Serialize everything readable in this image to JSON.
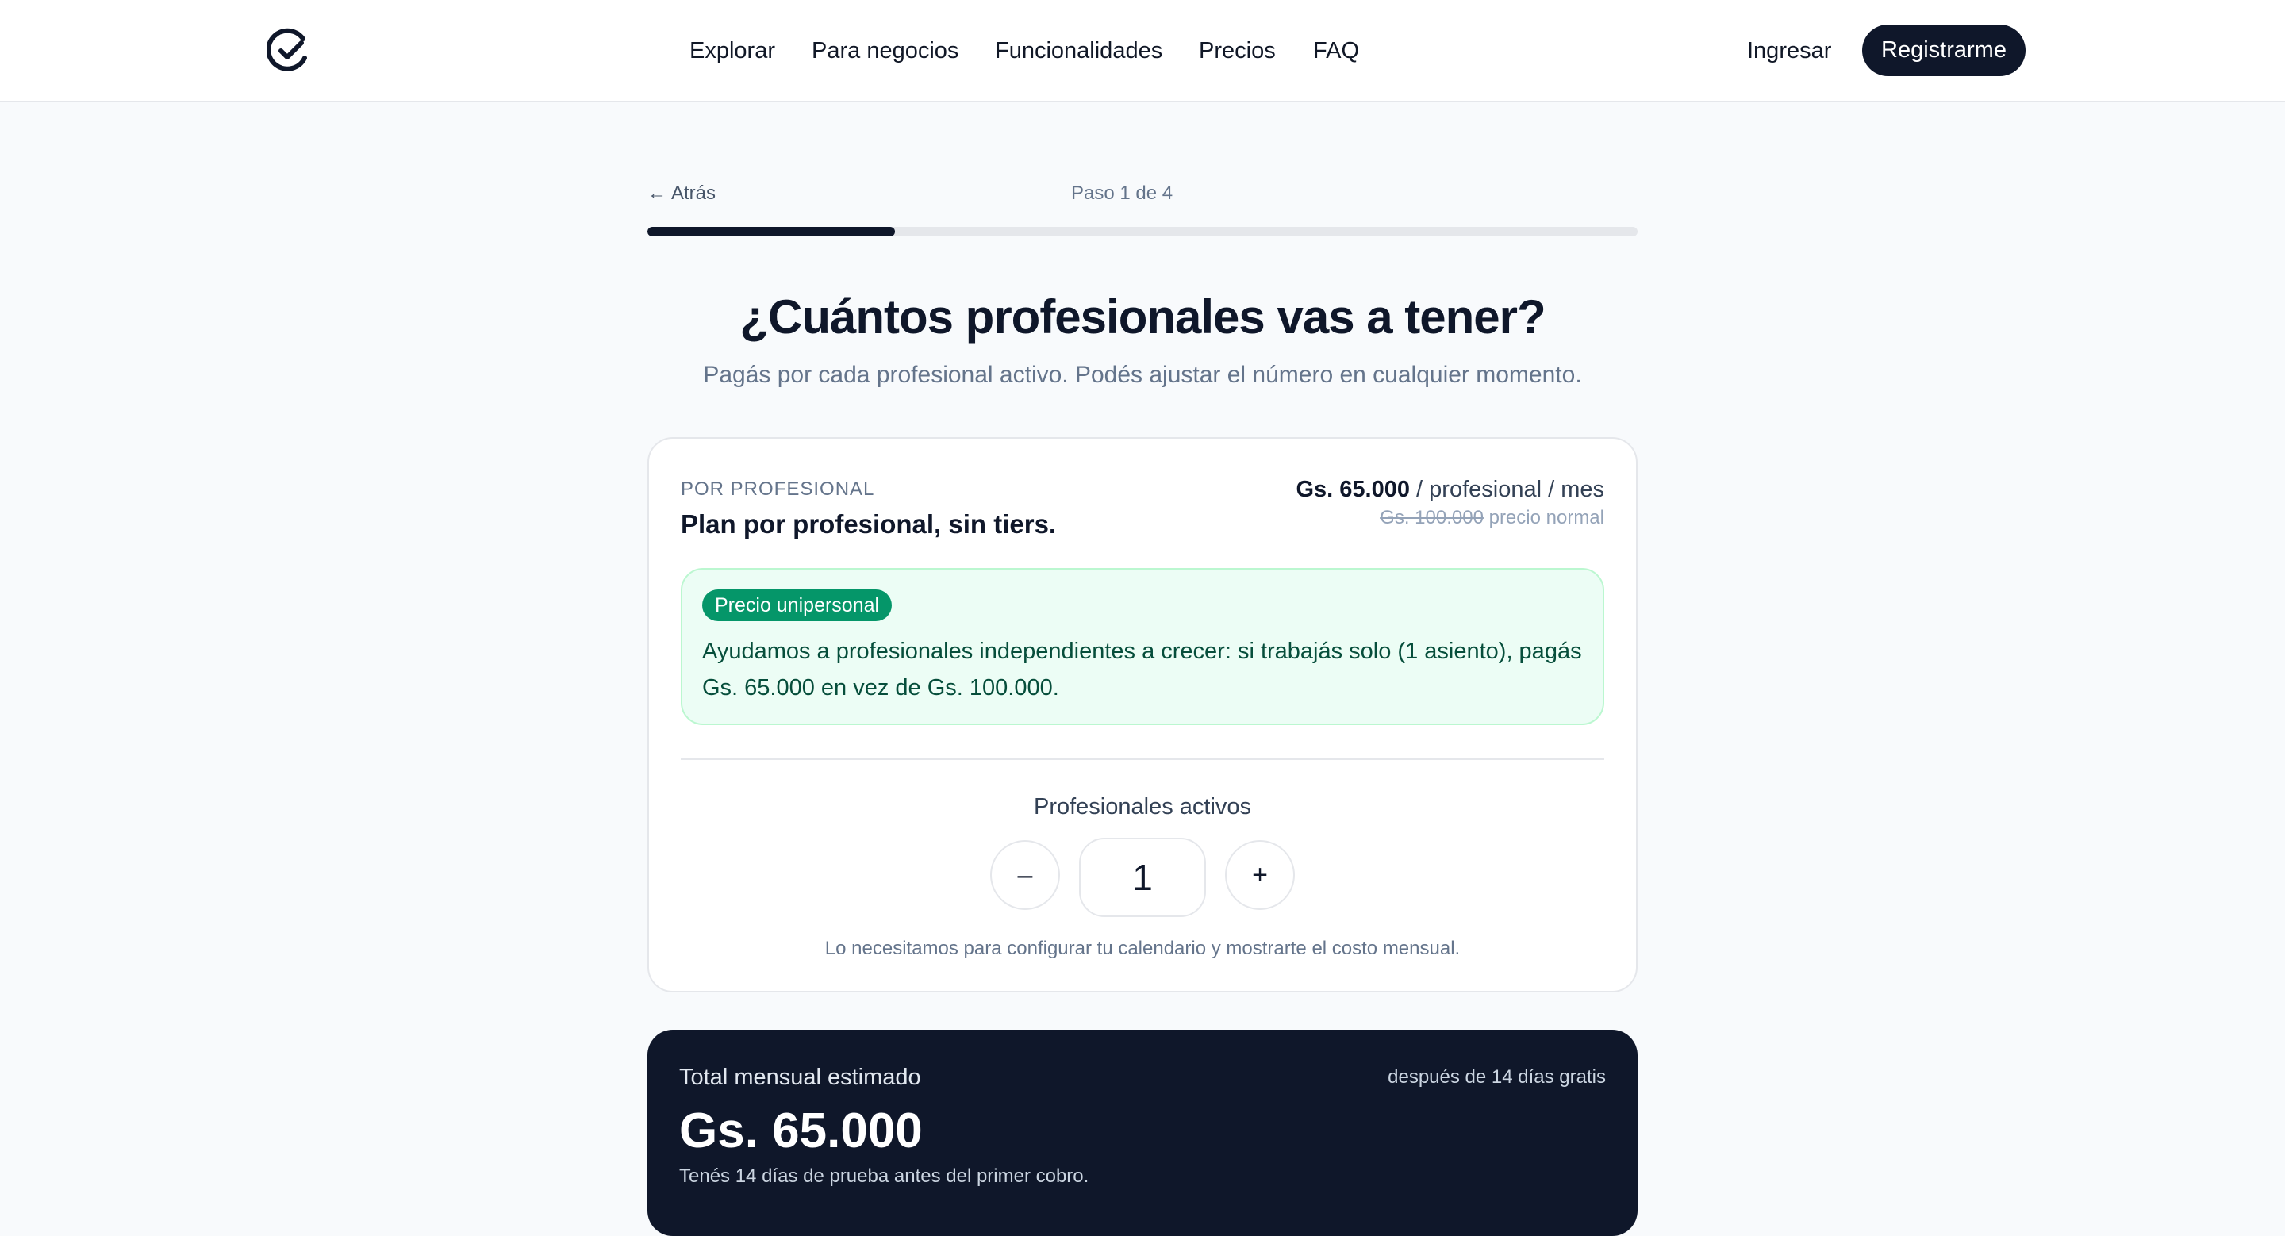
{
  "header": {
    "logo_icon": "check-circle-logo-icon",
    "nav": [
      "Explorar",
      "Para negocios",
      "Funcionalidades",
      "Precios",
      "FAQ"
    ],
    "login_label": "Ingresar",
    "register_label": "Registrarme"
  },
  "stepper": {
    "back_label": "Atrás",
    "back_icon": "arrow-left-icon",
    "step_text": "Paso 1 de 4",
    "current_step": 1,
    "total_steps": 4,
    "progress_fraction": 0.25
  },
  "page": {
    "title": "¿Cuántos profesionales vas a tener?",
    "subtitle": "Pagás por cada profesional activo. Podés ajustar el número en cualquier momento."
  },
  "plan": {
    "eyebrow": "POR PROFESIONAL",
    "name": "Plan por profesional, sin tiers.",
    "price": "Gs. 65.000",
    "price_unit": "/ profesional / mes",
    "old_price": "Gs. 100.000",
    "old_price_label": "precio normal",
    "promo_badge": "Precio unipersonal",
    "promo_text": "Ayudamos a profesionales independientes a crecer: si trabajás solo (1 asiento), pagás Gs. 65.000 en vez de Gs. 100.000.",
    "stepper_label": "Profesionales activos",
    "minus_label": "–",
    "plus_label": "+",
    "quantity": "1",
    "helper": "Lo necesitamos para configurar tu calendario y mostrarte el costo mensual."
  },
  "total": {
    "label": "Total mensual estimado",
    "note": "después de 14 días gratis",
    "amount": "Gs. 65.000",
    "sub": "Tenés 14 días de prueba antes del primer cobro."
  },
  "colors": {
    "brand_dark": "#0f172a",
    "promo_green": "#059669",
    "promo_bg": "#ecfdf5",
    "page_bg": "#f8fafc"
  }
}
